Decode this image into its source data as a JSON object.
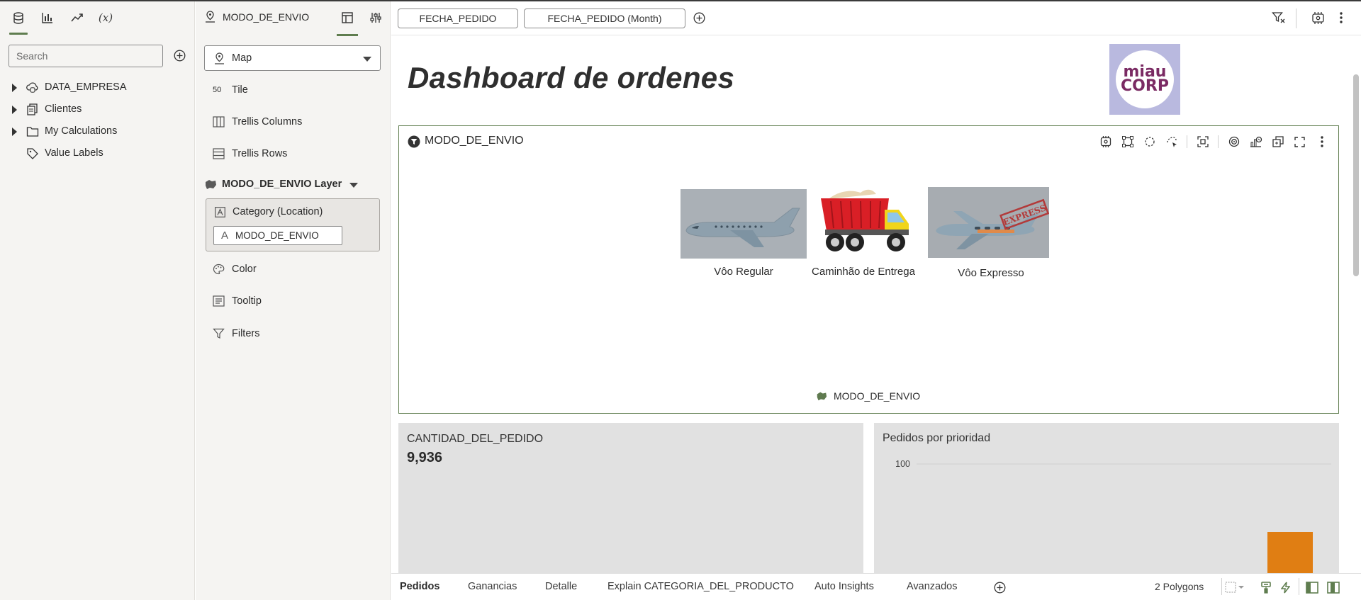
{
  "left_panel": {
    "tabs": [
      {
        "name": "data-icon"
      },
      {
        "name": "visualizations-icon"
      },
      {
        "name": "analytics-icon"
      },
      {
        "name": "calculations-icon",
        "label": "(x)"
      }
    ],
    "search": {
      "placeholder": "Search"
    },
    "tree": [
      {
        "label": "DATA_EMPRESA",
        "icon": "cloud-database-icon",
        "expandable": true
      },
      {
        "label": "Clientes",
        "icon": "dataset-icon",
        "expandable": true
      },
      {
        "label": "My Calculations",
        "icon": "folder-icon",
        "expandable": true
      },
      {
        "label": "Value Labels",
        "icon": "tag-icon",
        "expandable": false
      }
    ]
  },
  "grammar": {
    "title": "MODO_DE_ENVIO",
    "viz_type": "Map",
    "rows": {
      "tile": "Tile",
      "trellis_columns": "Trellis Columns",
      "trellis_rows": "Trellis Rows",
      "color": "Color",
      "tooltip": "Tooltip",
      "filters": "Filters"
    },
    "layer": "MODO_DE_ENVIO Layer",
    "category": {
      "label": "Category (Location)",
      "pill": "MODO_DE_ENVIO"
    }
  },
  "filterbar": {
    "chips": [
      "FECHA_PEDIDO",
      "FECHA_PEDIDO (Month)"
    ]
  },
  "canvas": {
    "title": "Dashboard de ordenes",
    "logo": {
      "line1": "miau",
      "line2": "CORP"
    },
    "map_viz": {
      "title": "MODO_DE_ENVIO",
      "items": [
        "Vôo Regular",
        "Caminhão de Entrega",
        "Vôo Expresso"
      ],
      "stamp": "EXPRESS",
      "legend": "MODO_DE_ENVIO"
    },
    "tile": {
      "label": "CANTIDAD_DEL_PEDIDO",
      "value": "9,936"
    },
    "bar_chart": {
      "title": "Pedidos por prioridad"
    }
  },
  "chart_data": {
    "type": "bar",
    "title": "Pedidos por prioridad",
    "yticks": [
      "100"
    ],
    "series": [
      {
        "color": "#e07e13"
      }
    ]
  },
  "bottombar": {
    "tabs": [
      "Pedidos",
      "Ganancias",
      "Detalle",
      "Explain CATEGORIA_DEL_PRODUCTO",
      "Auto Insights",
      "Avanzados"
    ],
    "active_tab": "Pedidos",
    "status": "2 Polygons"
  },
  "colors": {
    "accent": "#5f7d4f",
    "bar": "#e07e13",
    "panel": "#f5f4f2"
  }
}
